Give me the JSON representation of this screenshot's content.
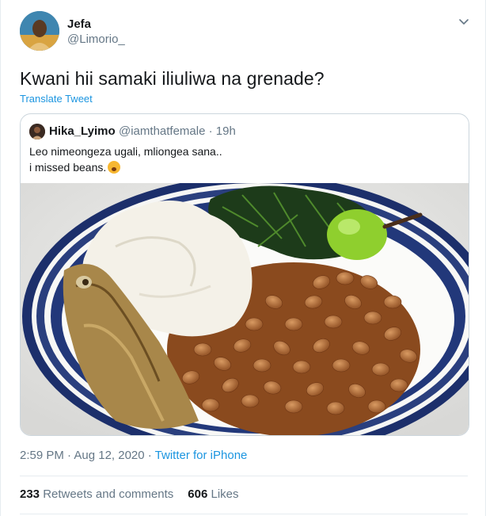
{
  "author": {
    "name": "Jefa",
    "handle": "@Limorio_"
  },
  "tweet": {
    "text": "Kwani hii samaki iliuliwa na grenade?",
    "translate_label": "Translate Tweet"
  },
  "quoted_tweet": {
    "name": "Hika_Lyimo",
    "handle": "@iamthatfemale · 19h",
    "text_line1": "Leo nimeongeza ugali, mliongea sana..",
    "text_line2": "i missed beans.",
    "emoji": "face-with-open-mouth-emoji",
    "image": "plate-of-fish-ugali-beans-greens-photo"
  },
  "meta": {
    "timestamp": "2:59 PM · Aug 12, 2020 · ",
    "source": "Twitter for iPhone"
  },
  "stats": {
    "retweets_count": "233",
    "retweets_label": "Retweets and comments",
    "likes_count": "606",
    "likes_label": "Likes"
  },
  "icons": {
    "menu": "chevron-down-icon"
  },
  "colors": {
    "link": "#1b95e0",
    "secondary_text": "#657786",
    "border": "#ccd6dd"
  }
}
